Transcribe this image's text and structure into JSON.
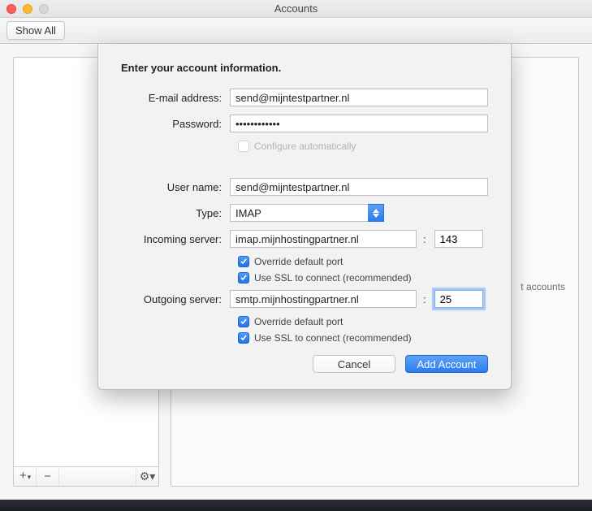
{
  "window": {
    "title": "Accounts",
    "show_all": "Show All"
  },
  "sidebar": {
    "add_icon": "+",
    "remove_icon": "−",
    "gear_icon": "⚙︎▾"
  },
  "placeholder": {
    "text": "t accounts"
  },
  "sheet": {
    "heading": "Enter your account information.",
    "email_label": "E-mail address:",
    "email_value": "send@mijntestpartner.nl",
    "password_label": "Password:",
    "password_value": "••••••••••••",
    "configure_auto_label": "Configure automatically",
    "username_label": "User name:",
    "username_value": "send@mijntestpartner.nl",
    "type_label": "Type:",
    "type_value": "IMAP",
    "incoming_label": "Incoming server:",
    "incoming_value": "imap.mijnhostingpartner.nl",
    "incoming_port": "143",
    "override_port_label": "Override default port",
    "use_ssl_label": "Use SSL to connect (recommended)",
    "outgoing_label": "Outgoing server:",
    "outgoing_value": "smtp.mijnhostingpartner.nl",
    "outgoing_port": "25",
    "cancel": "Cancel",
    "add_account": "Add Account"
  }
}
